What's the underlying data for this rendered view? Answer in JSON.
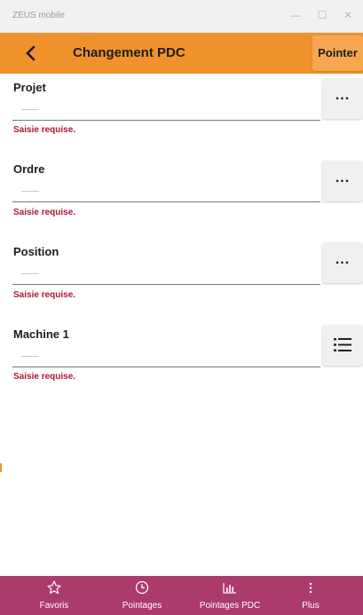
{
  "window": {
    "title": "ZEUS mobile"
  },
  "appbar": {
    "title": "Changement PDC",
    "pointer_label": "Pointer"
  },
  "fields": [
    {
      "label": "Projet",
      "error": "Saisie requise.",
      "button": "..."
    },
    {
      "label": "Ordre",
      "error": "Saisie requise.",
      "button": "..."
    },
    {
      "label": "Position",
      "error": "Saisie requise.",
      "button": "..."
    },
    {
      "label": "Machine",
      "label_suffix": "1",
      "error": "Saisie requise.",
      "button_icon": "list-icon"
    }
  ],
  "bottom_nav": [
    {
      "label": "Favoris",
      "icon": "star-icon"
    },
    {
      "label": "Pointages",
      "icon": "clock-icon"
    },
    {
      "label": "Pointages PDC",
      "icon": "bar-chart-icon"
    },
    {
      "label": "Plus",
      "icon": "more-vertical-icon"
    }
  ],
  "colors": {
    "appbar": "#f0922b",
    "bottom_nav": "#ab3b6b",
    "error": "#b01537"
  }
}
